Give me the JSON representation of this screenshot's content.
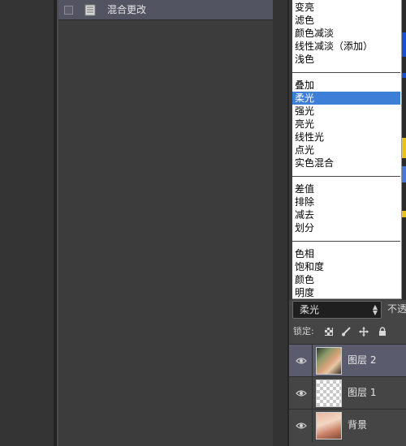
{
  "history": {
    "item_label": "混合更改"
  },
  "blend_menu": {
    "groups": [
      [
        "变亮",
        "滤色",
        "颜色减淡",
        "线性减淡（添加）",
        "浅色"
      ],
      [
        "叠加",
        "柔光",
        "强光",
        "亮光",
        "线性光",
        "点光",
        "实色混合"
      ],
      [
        "差值",
        "排除",
        "减去",
        "划分"
      ],
      [
        "色相",
        "饱和度",
        "颜色",
        "明度"
      ]
    ],
    "selected": "柔光"
  },
  "layers": {
    "blend_mode_value": "柔光",
    "opacity_label": "不透",
    "lock_label": "锁定:",
    "rows": [
      {
        "name": "图层 2",
        "selected": true
      },
      {
        "name": "图层 1",
        "selected": false
      },
      {
        "name": "背景",
        "selected": false
      }
    ]
  },
  "colors": {
    "menu_highlight": "#3d7fd6",
    "selected_layer": "#5a5c6e",
    "history_row": "#525462"
  },
  "icons": [
    "history-snapshot-icon",
    "eye-icon",
    "lock-transparent-icon",
    "lock-brush-icon",
    "lock-move-icon",
    "lock-all-icon",
    "select-arrows-icon"
  ]
}
